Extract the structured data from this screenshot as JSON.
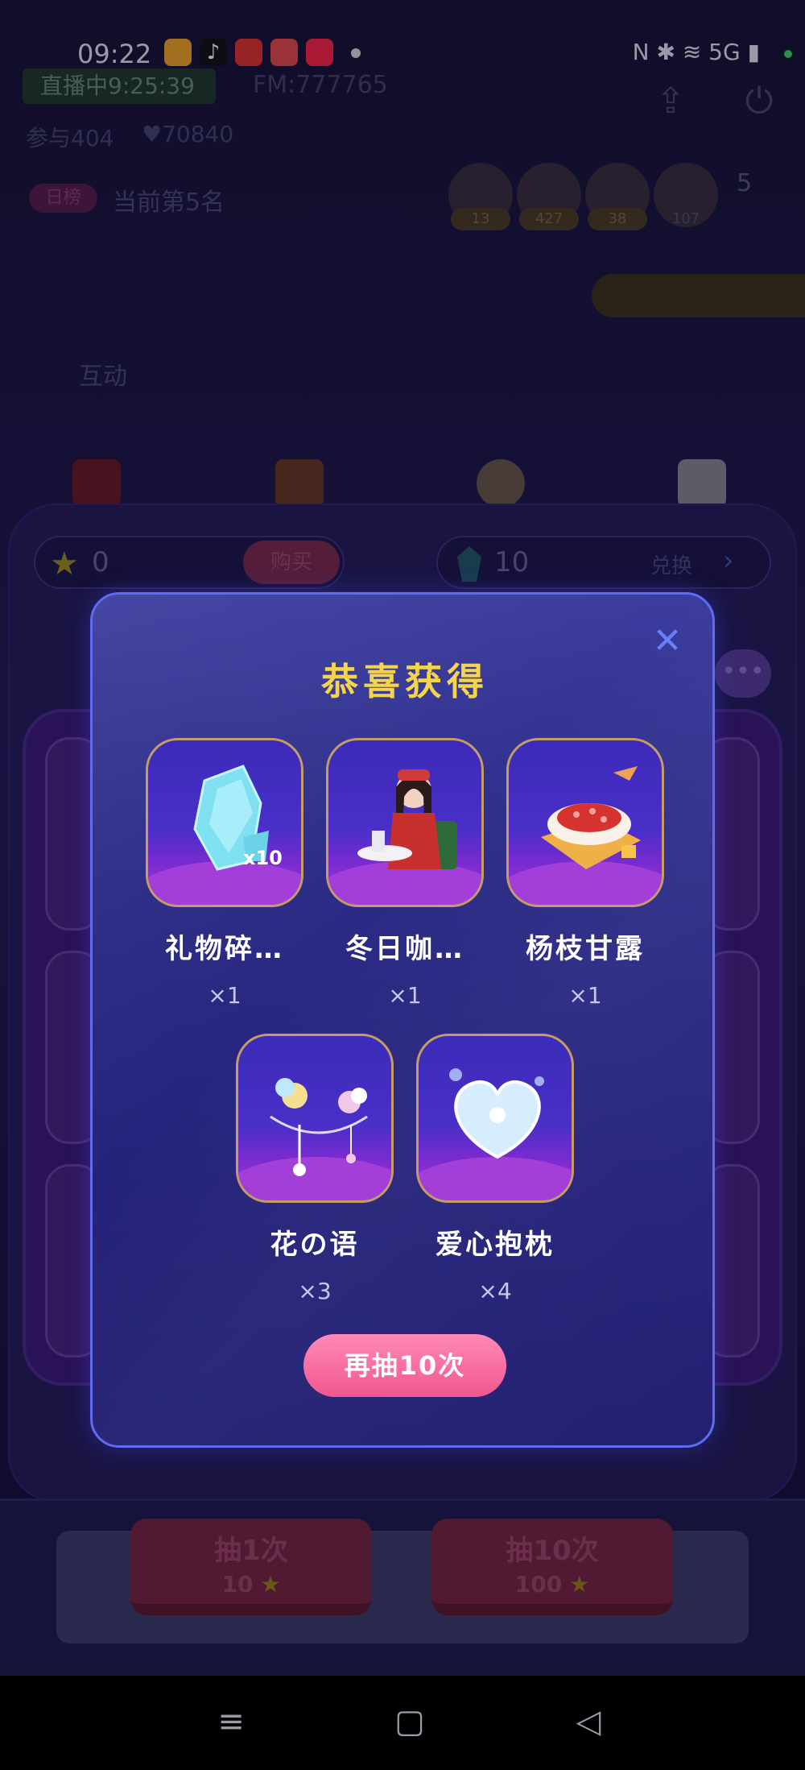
{
  "status_bar": {
    "time": "09:22",
    "right_icons": "N ✱ ≋ 5G ▮"
  },
  "room": {
    "live_timer": "直播中9:25:39",
    "fm": "FM:777765",
    "participants": "参与404",
    "likes": "♥70840",
    "rank_badge": "日榜",
    "rank_text": "当前第5名",
    "audience_counts": [
      "13",
      "427",
      "38",
      "107"
    ],
    "audience_more": "5",
    "interact_label": "互动"
  },
  "game": {
    "star_balance": "0",
    "buy_label": "购买",
    "gem_balance": "10",
    "exchange_label": "兑换",
    "draw_once": {
      "label": "抽1次",
      "cost": "10"
    },
    "draw_ten": {
      "label": "抽10次",
      "cost": "100"
    }
  },
  "modal": {
    "title": "恭喜获得",
    "prizes": [
      {
        "name": "礼物碎…",
        "qty": "×1",
        "badge": "x10",
        "icon": "crystal-shard-icon"
      },
      {
        "name": "冬日咖…",
        "qty": "×1",
        "icon": "winter-coffee-girl-icon"
      },
      {
        "name": "杨枝甘露",
        "qty": "×1",
        "icon": "mango-dessert-icon"
      },
      {
        "name": "花の语",
        "qty": "×3",
        "icon": "flower-chain-icon"
      },
      {
        "name": "爱心抱枕",
        "qty": "×4",
        "icon": "heart-pillow-icon"
      }
    ],
    "again_button": "再抽10次"
  },
  "colors": {
    "title_gold": "#f3d44a",
    "again_pink": "#f0578f",
    "modal_border": "#5f6cf0",
    "card_border": "#c79b66"
  }
}
